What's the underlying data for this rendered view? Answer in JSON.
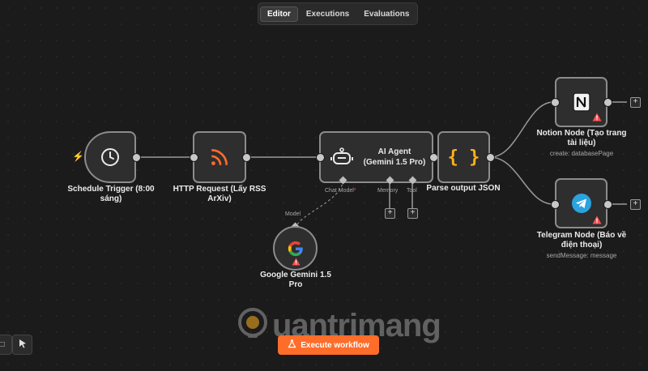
{
  "tabs": [
    {
      "label": "Editor",
      "active": true
    },
    {
      "label": "Executions",
      "active": false
    },
    {
      "label": "Evaluations",
      "active": false
    }
  ],
  "nodes": {
    "schedule_trigger": {
      "label": "Schedule Trigger (8:00 sáng)",
      "icon": "clock-icon"
    },
    "http_request": {
      "label": "HTTP Request (Lấy RSS ArXiv)",
      "icon": "rss-icon"
    },
    "ai_agent": {
      "label": "AI Agent",
      "sublabel": "(Gemini 1.5 Pro)",
      "icon": "robot-icon",
      "ports": {
        "chat_model": "Chat Model",
        "memory": "Memory",
        "tool": "Tool"
      }
    },
    "parse_output": {
      "label": "Parse output JSON",
      "icon": "braces-icon"
    },
    "notion": {
      "label": "Notion Node (Tạo trang tài liệu)",
      "operation": "create: databasePage",
      "icon": "notion-icon"
    },
    "telegram": {
      "label": "Telegram Node (Báo về điện thoại)",
      "operation": "sendMessage: message",
      "icon": "telegram-icon"
    },
    "gemini": {
      "label": "Google Gemini 1.5 Pro",
      "port": "Model",
      "icon": "google-icon"
    }
  },
  "execute_button": {
    "label": "Execute workflow"
  },
  "watermark": {
    "text": "uantrimang"
  },
  "colors": {
    "accent": "#ff6d2a",
    "warning": "#ff4d4d",
    "node_border": "#8c8c8c"
  }
}
